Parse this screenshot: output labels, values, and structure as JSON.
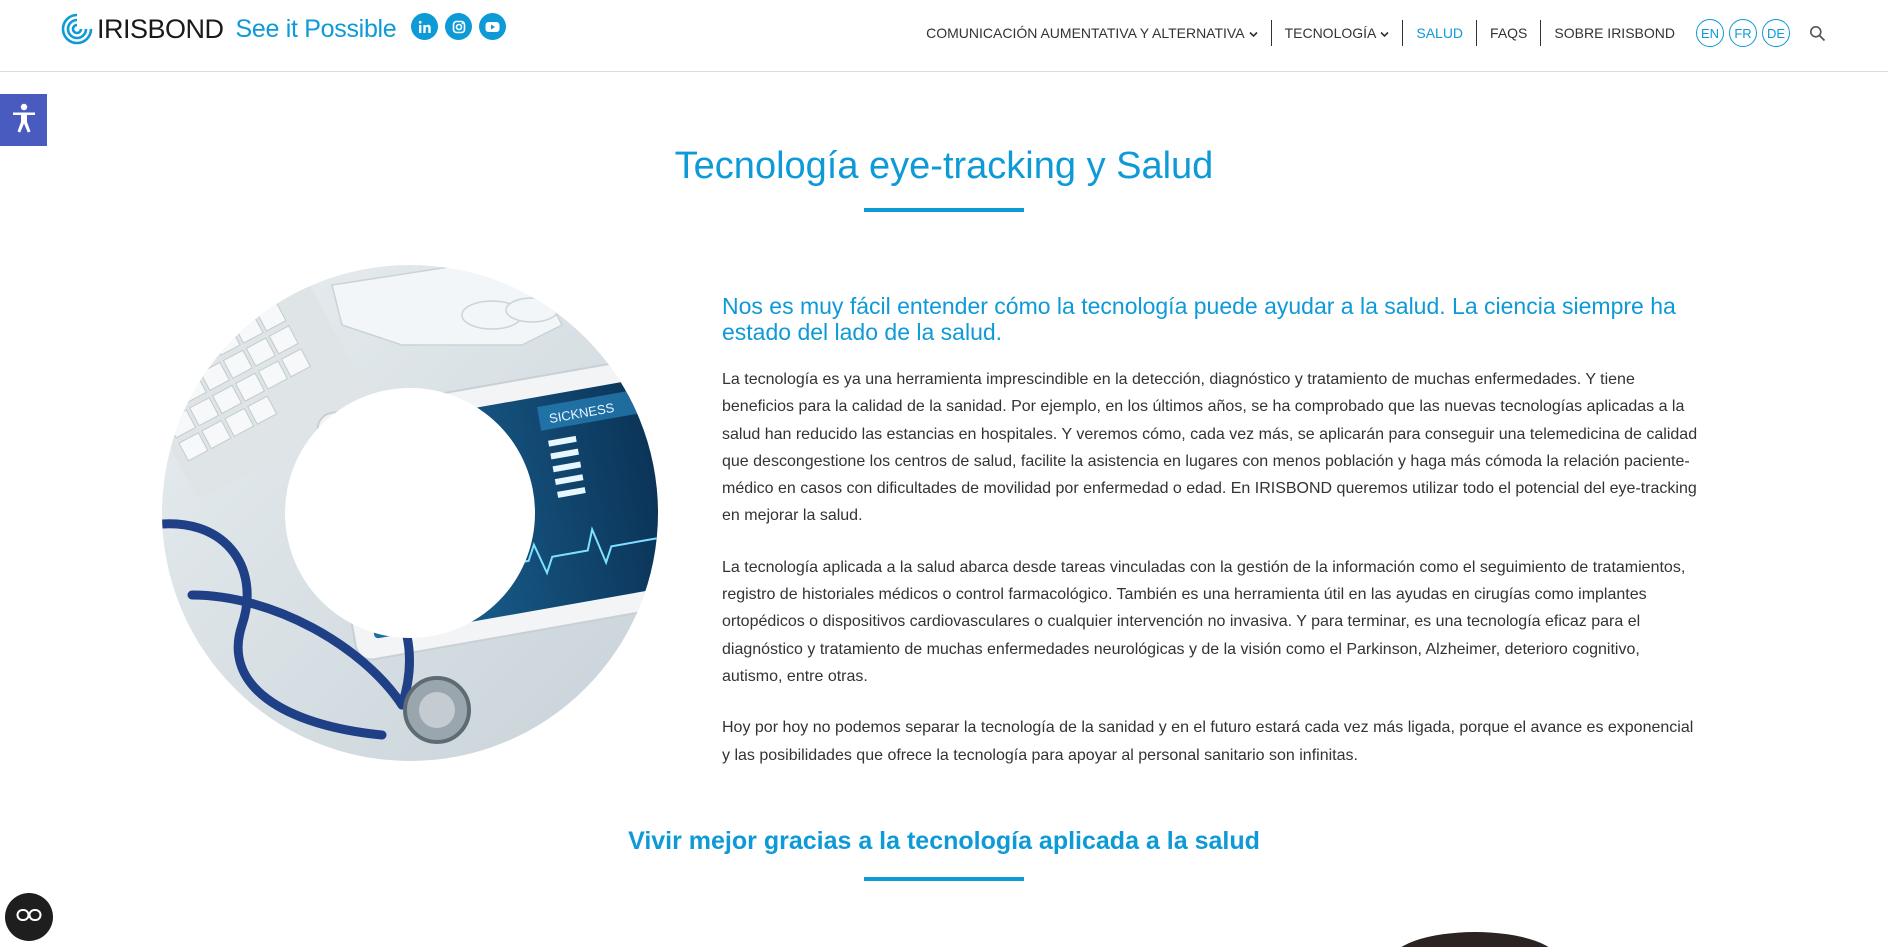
{
  "header": {
    "brand": "IRISBOND",
    "tagline": "See it Possible",
    "socials": [
      "linkedin-icon",
      "instagram-icon",
      "youtube-icon"
    ],
    "nav": [
      {
        "label": "COMUNICACIÓN AUMENTATIVA Y ALTERNATIVA",
        "dropdown": true
      },
      {
        "label": "TECNOLOGÍA",
        "dropdown": true
      },
      {
        "label": "SALUD",
        "active": true
      },
      {
        "label": "FAQS"
      },
      {
        "label": "SOBRE IRISBOND"
      }
    ],
    "languages": [
      "EN",
      "FR",
      "DE"
    ],
    "search_icon": "search-icon"
  },
  "colors": {
    "accent": "#0d9ad6",
    "text": "#333333",
    "a11y_tab": "#4a5bbf"
  },
  "main": {
    "title": "Tecnología eye-tracking y Salud",
    "lead": "Nos es muy fácil entender cómo la tecnología puede ayudar a la salud. La ciencia siempre ha estado del lado de la salud.",
    "paragraphs": [
      "La tecnología es ya una herramienta imprescindible en la detección, diagnóstico y tratamiento de muchas enfermedades. Y tiene beneficios para la calidad de la sanidad. Por ejemplo, en los últimos años, se ha comprobado que las nuevas tecnologías aplicadas a la salud han reducido las estancias en hospitales. Y veremos cómo, cada vez más, se aplicarán para conseguir una telemedicina de calidad que descongestione los centros de salud, facilite la asistencia en lugares con menos población y haga más cómoda la relación paciente-médico en casos con dificultades de movilidad por enfermedad o edad. En IRISBOND queremos utilizar todo el potencial del eye-tracking en mejorar la salud.",
      "La tecnología aplicada a la salud abarca desde tareas vinculadas con la gestión de la información como el seguimiento de tratamientos, registro de historiales médicos o control farmacológico. También es una herramienta útil en las ayudas en cirugías como implantes ortopédicos o dispositivos cardiovasculares o cualquier intervención no invasiva. Y para terminar, es una tecnología eficaz para el diagnóstico y tratamiento de muchas enfermedades neurológicas y de la visión como el Parkinson, Alzheimer, deterioro cognitivo, autismo, entre otras.",
      "Hoy por hoy no podemos separar la tecnología de la sanidad y en el futuro estará cada vez más ligada, porque el avance es exponencial y las posibilidades que ofrece la tecnología para apoyar al personal sanitario son infinitas."
    ],
    "image_text": "SICKNESS",
    "subtitle": "Vivir mejor gracias a la tecnología aplicada a la salud"
  }
}
